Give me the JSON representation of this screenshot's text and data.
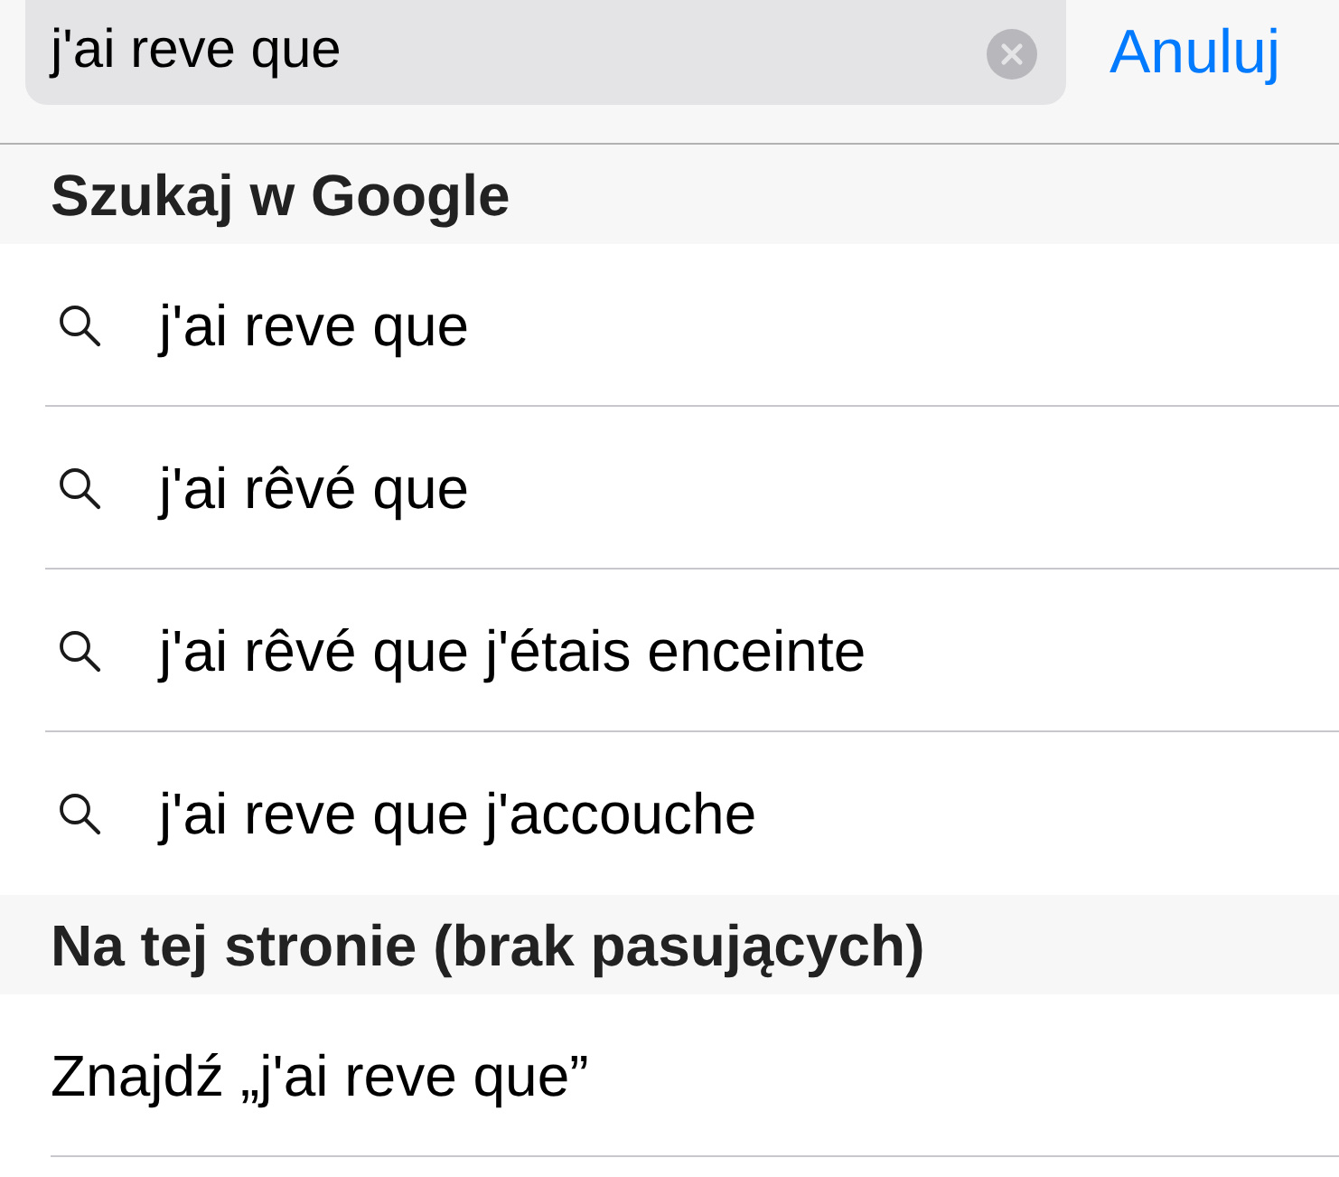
{
  "search_bar": {
    "value": "j'ai reve que",
    "cancel_label": "Anuluj"
  },
  "sections": [
    {
      "header": "Szukaj w Google",
      "items": [
        {
          "kind": "suggestion",
          "text": "j'ai reve que"
        },
        {
          "kind": "suggestion",
          "text": "j'ai rêvé que"
        },
        {
          "kind": "suggestion",
          "text": "j'ai rêvé que j'étais enceinte"
        },
        {
          "kind": "suggestion",
          "text": "j'ai reve que j'accouche"
        }
      ]
    },
    {
      "header": "Na tej stronie (brak pasujących)",
      "items": [
        {
          "kind": "find",
          "text": "Znajdź „j'ai reve que”"
        }
      ]
    }
  ]
}
